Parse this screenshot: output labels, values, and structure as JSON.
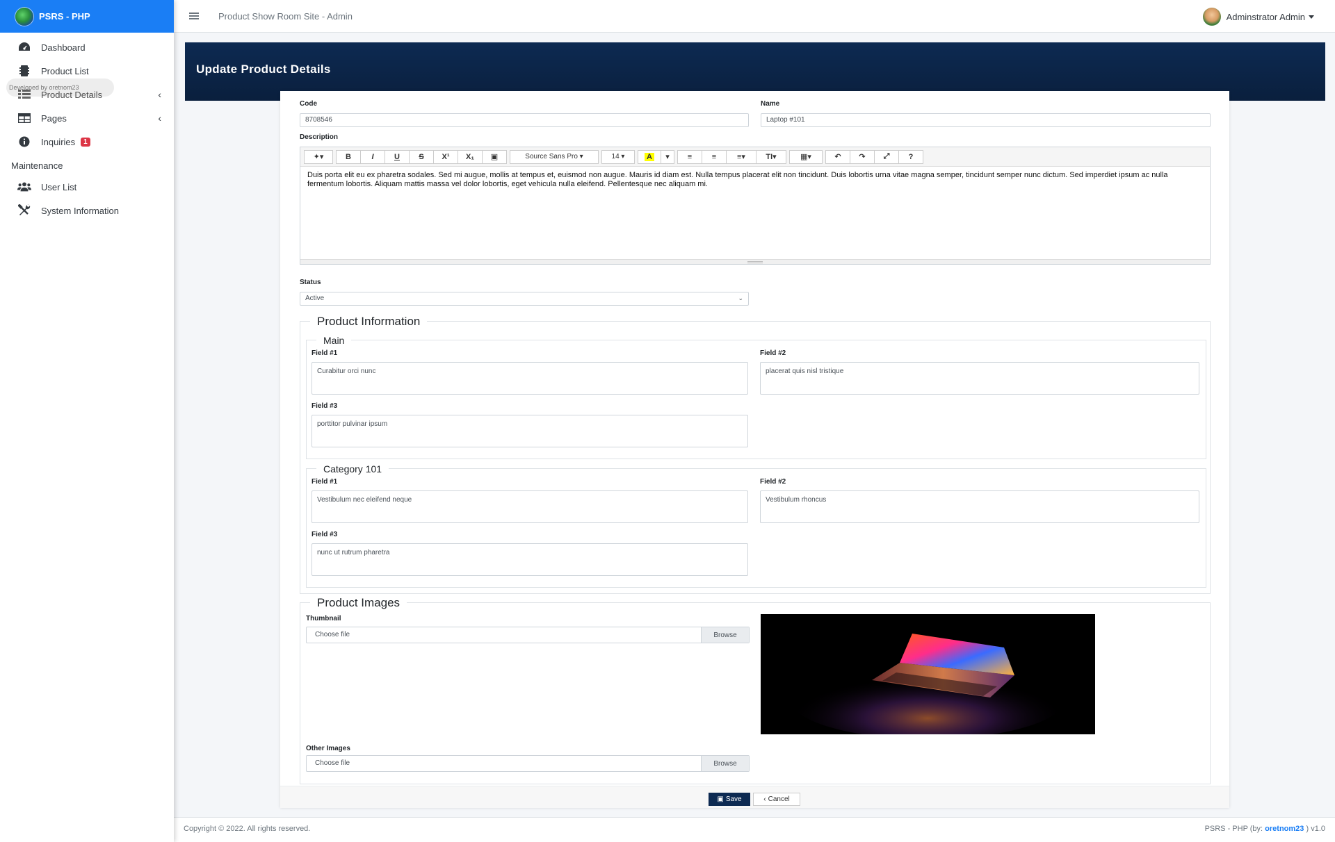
{
  "brand": {
    "title": "PSRS - PHP"
  },
  "sidebar": {
    "items": [
      {
        "label": "Dashboard",
        "icon": "dashboard-icon"
      },
      {
        "label": "Product List",
        "icon": "product-list-icon"
      },
      {
        "label": "Product Details",
        "icon": "product-details-icon"
      },
      {
        "label": "Pages",
        "icon": "pages-icon"
      },
      {
        "label": "Inquiries",
        "icon": "info-icon",
        "badge": "1"
      }
    ],
    "maintenance_header": "Maintenance",
    "maintenance_items": [
      {
        "label": "User List",
        "icon": "users-icon"
      },
      {
        "label": "System Information",
        "icon": "tools-icon"
      }
    ],
    "watermark": "Developed by oretnom23"
  },
  "topbar": {
    "site_title": "Product Show Room Site - Admin",
    "user_name": "Adminstrator Admin"
  },
  "page": {
    "title": "Update Product Details"
  },
  "form": {
    "code_label": "Code",
    "code_value": "8708546",
    "name_label": "Name",
    "name_value": "Laptop #101",
    "description_label": "Description",
    "description_text": "Duis porta elit eu ex pharetra sodales. Sed mi augue, mollis at tempus et, euismod non augue. Mauris id diam est. Nulla tempus placerat elit non tincidunt. Duis lobortis urna vitae magna semper, tincidunt semper nunc dictum. Sed imperdiet ipsum ac nulla fermentum lobortis. Aliquam mattis massa vel dolor lobortis, eget vehicula nulla eleifend. Pellentesque nec aliquam mi.",
    "editor_font": "Source Sans Pro",
    "editor_size": "14",
    "status_label": "Status",
    "status_value": "Active"
  },
  "product_info": {
    "legend": "Product Information",
    "main": {
      "legend": "Main",
      "field1_label": "Field #1",
      "field1_value": "Curabitur orci nunc",
      "field2_label": "Field #2",
      "field2_value": "placerat quis nisl tristique",
      "field3_label": "Field #3",
      "field3_value": "porttitor pulvinar ipsum"
    },
    "category": {
      "legend": "Category 101",
      "field1_label": "Field #1",
      "field1_value": "Vestibulum nec eleifend neque",
      "field2_label": "Field #2",
      "field2_value": "Vestibulum rhoncus",
      "field3_label": "Field #3",
      "field3_value": "nunc ut rutrum pharetra"
    }
  },
  "images": {
    "legend": "Product Images",
    "thumbnail_label": "Thumbnail",
    "other_label": "Other Images",
    "choose_file": "Choose file",
    "browse": "Browse"
  },
  "actions": {
    "save": "Save",
    "cancel": "Cancel"
  },
  "footer": {
    "copyright": "Copyright © 2022. All rights reserved.",
    "credit_prefix": "PSRS - PHP (by: ",
    "credit_author": "oretnom23",
    "credit_suffix": " ) v1.0"
  }
}
